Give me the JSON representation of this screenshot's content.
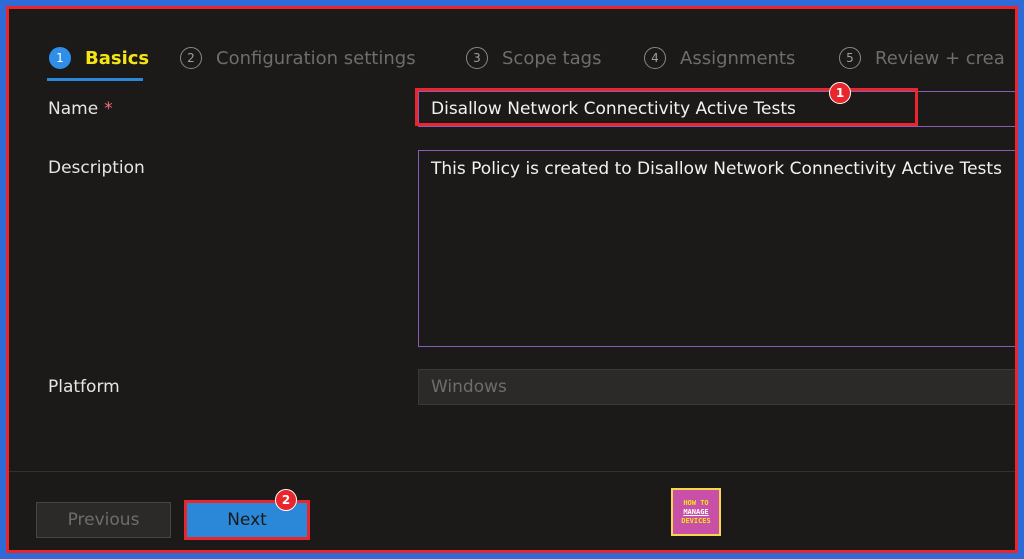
{
  "steps": [
    {
      "num": "1",
      "label": "Basics"
    },
    {
      "num": "2",
      "label": "Configuration settings"
    },
    {
      "num": "3",
      "label": "Scope tags"
    },
    {
      "num": "4",
      "label": "Assignments"
    },
    {
      "num": "5",
      "label": "Review + crea"
    }
  ],
  "form": {
    "name_label": "Name",
    "required_mark": "*",
    "name_value": "Disallow Network Connectivity Active Tests",
    "description_label": "Description",
    "description_value": "This Policy is created to Disallow Network Connectivity Active Tests",
    "platform_label": "Platform",
    "platform_value": "Windows"
  },
  "footer": {
    "previous_label": "Previous",
    "next_label": "Next"
  },
  "annotations": {
    "badge1": "1",
    "badge2": "2"
  },
  "logo": {
    "line1": "HOW TO",
    "line2": "MANAGE",
    "line3": "DEVICES"
  },
  "colors": {
    "accent": "#2b88d8",
    "active_tab_text": "#f5e514",
    "highlight": "#e8262c",
    "background": "#1b1a19"
  }
}
